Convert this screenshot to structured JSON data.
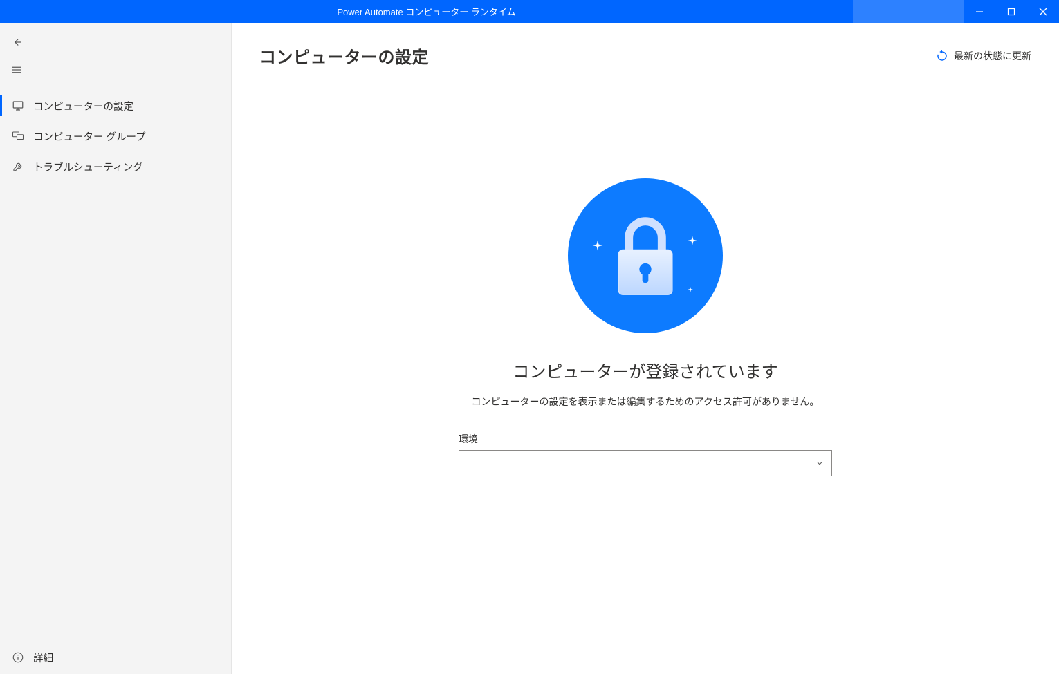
{
  "titlebar": {
    "title": "Power Automate コンピューター ランタイム"
  },
  "sidebar": {
    "items": [
      {
        "label": "コンピューターの設定",
        "active": true
      },
      {
        "label": "コンピューター グループ",
        "active": false
      },
      {
        "label": "トラブルシューティング",
        "active": false
      }
    ],
    "footer_label": "詳細"
  },
  "main": {
    "page_title": "コンピューターの設定",
    "refresh_label": "最新の状態に更新",
    "status_title": "コンピューターが登録されています",
    "status_desc": "コンピューターの設定を表示または編集するためのアクセス許可がありません。",
    "env_label": "環境",
    "env_selected": ""
  },
  "colors": {
    "accent": "#0066ff"
  }
}
